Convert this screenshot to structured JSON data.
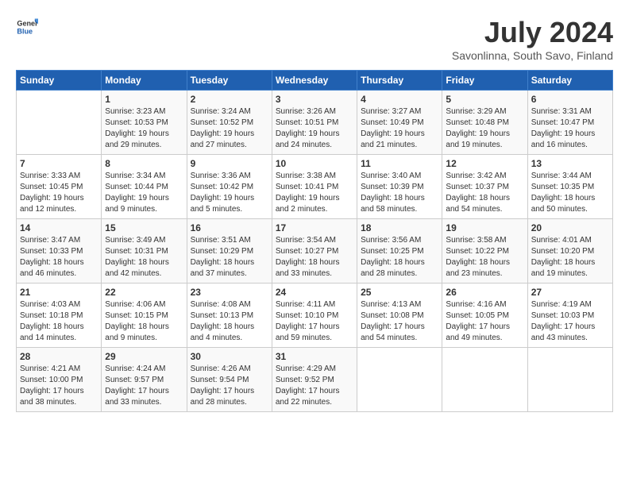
{
  "header": {
    "logo_general": "General",
    "logo_blue": "Blue",
    "month_title": "July 2024",
    "subtitle": "Savonlinna, South Savo, Finland"
  },
  "weekdays": [
    "Sunday",
    "Monday",
    "Tuesday",
    "Wednesday",
    "Thursday",
    "Friday",
    "Saturday"
  ],
  "weeks": [
    [
      {
        "day": "",
        "sunrise": "",
        "sunset": "",
        "daylight": ""
      },
      {
        "day": "1",
        "sunrise": "Sunrise: 3:23 AM",
        "sunset": "Sunset: 10:53 PM",
        "daylight": "Daylight: 19 hours and 29 minutes."
      },
      {
        "day": "2",
        "sunrise": "Sunrise: 3:24 AM",
        "sunset": "Sunset: 10:52 PM",
        "daylight": "Daylight: 19 hours and 27 minutes."
      },
      {
        "day": "3",
        "sunrise": "Sunrise: 3:26 AM",
        "sunset": "Sunset: 10:51 PM",
        "daylight": "Daylight: 19 hours and 24 minutes."
      },
      {
        "day": "4",
        "sunrise": "Sunrise: 3:27 AM",
        "sunset": "Sunset: 10:49 PM",
        "daylight": "Daylight: 19 hours and 21 minutes."
      },
      {
        "day": "5",
        "sunrise": "Sunrise: 3:29 AM",
        "sunset": "Sunset: 10:48 PM",
        "daylight": "Daylight: 19 hours and 19 minutes."
      },
      {
        "day": "6",
        "sunrise": "Sunrise: 3:31 AM",
        "sunset": "Sunset: 10:47 PM",
        "daylight": "Daylight: 19 hours and 16 minutes."
      }
    ],
    [
      {
        "day": "7",
        "sunrise": "Sunrise: 3:33 AM",
        "sunset": "Sunset: 10:45 PM",
        "daylight": "Daylight: 19 hours and 12 minutes."
      },
      {
        "day": "8",
        "sunrise": "Sunrise: 3:34 AM",
        "sunset": "Sunset: 10:44 PM",
        "daylight": "Daylight: 19 hours and 9 minutes."
      },
      {
        "day": "9",
        "sunrise": "Sunrise: 3:36 AM",
        "sunset": "Sunset: 10:42 PM",
        "daylight": "Daylight: 19 hours and 5 minutes."
      },
      {
        "day": "10",
        "sunrise": "Sunrise: 3:38 AM",
        "sunset": "Sunset: 10:41 PM",
        "daylight": "Daylight: 19 hours and 2 minutes."
      },
      {
        "day": "11",
        "sunrise": "Sunrise: 3:40 AM",
        "sunset": "Sunset: 10:39 PM",
        "daylight": "Daylight: 18 hours and 58 minutes."
      },
      {
        "day": "12",
        "sunrise": "Sunrise: 3:42 AM",
        "sunset": "Sunset: 10:37 PM",
        "daylight": "Daylight: 18 hours and 54 minutes."
      },
      {
        "day": "13",
        "sunrise": "Sunrise: 3:44 AM",
        "sunset": "Sunset: 10:35 PM",
        "daylight": "Daylight: 18 hours and 50 minutes."
      }
    ],
    [
      {
        "day": "14",
        "sunrise": "Sunrise: 3:47 AM",
        "sunset": "Sunset: 10:33 PM",
        "daylight": "Daylight: 18 hours and 46 minutes."
      },
      {
        "day": "15",
        "sunrise": "Sunrise: 3:49 AM",
        "sunset": "Sunset: 10:31 PM",
        "daylight": "Daylight: 18 hours and 42 minutes."
      },
      {
        "day": "16",
        "sunrise": "Sunrise: 3:51 AM",
        "sunset": "Sunset: 10:29 PM",
        "daylight": "Daylight: 18 hours and 37 minutes."
      },
      {
        "day": "17",
        "sunrise": "Sunrise: 3:54 AM",
        "sunset": "Sunset: 10:27 PM",
        "daylight": "Daylight: 18 hours and 33 minutes."
      },
      {
        "day": "18",
        "sunrise": "Sunrise: 3:56 AM",
        "sunset": "Sunset: 10:25 PM",
        "daylight": "Daylight: 18 hours and 28 minutes."
      },
      {
        "day": "19",
        "sunrise": "Sunrise: 3:58 AM",
        "sunset": "Sunset: 10:22 PM",
        "daylight": "Daylight: 18 hours and 23 minutes."
      },
      {
        "day": "20",
        "sunrise": "Sunrise: 4:01 AM",
        "sunset": "Sunset: 10:20 PM",
        "daylight": "Daylight: 18 hours and 19 minutes."
      }
    ],
    [
      {
        "day": "21",
        "sunrise": "Sunrise: 4:03 AM",
        "sunset": "Sunset: 10:18 PM",
        "daylight": "Daylight: 18 hours and 14 minutes."
      },
      {
        "day": "22",
        "sunrise": "Sunrise: 4:06 AM",
        "sunset": "Sunset: 10:15 PM",
        "daylight": "Daylight: 18 hours and 9 minutes."
      },
      {
        "day": "23",
        "sunrise": "Sunrise: 4:08 AM",
        "sunset": "Sunset: 10:13 PM",
        "daylight": "Daylight: 18 hours and 4 minutes."
      },
      {
        "day": "24",
        "sunrise": "Sunrise: 4:11 AM",
        "sunset": "Sunset: 10:10 PM",
        "daylight": "Daylight: 17 hours and 59 minutes."
      },
      {
        "day": "25",
        "sunrise": "Sunrise: 4:13 AM",
        "sunset": "Sunset: 10:08 PM",
        "daylight": "Daylight: 17 hours and 54 minutes."
      },
      {
        "day": "26",
        "sunrise": "Sunrise: 4:16 AM",
        "sunset": "Sunset: 10:05 PM",
        "daylight": "Daylight: 17 hours and 49 minutes."
      },
      {
        "day": "27",
        "sunrise": "Sunrise: 4:19 AM",
        "sunset": "Sunset: 10:03 PM",
        "daylight": "Daylight: 17 hours and 43 minutes."
      }
    ],
    [
      {
        "day": "28",
        "sunrise": "Sunrise: 4:21 AM",
        "sunset": "Sunset: 10:00 PM",
        "daylight": "Daylight: 17 hours and 38 minutes."
      },
      {
        "day": "29",
        "sunrise": "Sunrise: 4:24 AM",
        "sunset": "Sunset: 9:57 PM",
        "daylight": "Daylight: 17 hours and 33 minutes."
      },
      {
        "day": "30",
        "sunrise": "Sunrise: 4:26 AM",
        "sunset": "Sunset: 9:54 PM",
        "daylight": "Daylight: 17 hours and 28 minutes."
      },
      {
        "day": "31",
        "sunrise": "Sunrise: 4:29 AM",
        "sunset": "Sunset: 9:52 PM",
        "daylight": "Daylight: 17 hours and 22 minutes."
      },
      {
        "day": "",
        "sunrise": "",
        "sunset": "",
        "daylight": ""
      },
      {
        "day": "",
        "sunrise": "",
        "sunset": "",
        "daylight": ""
      },
      {
        "day": "",
        "sunrise": "",
        "sunset": "",
        "daylight": ""
      }
    ]
  ]
}
